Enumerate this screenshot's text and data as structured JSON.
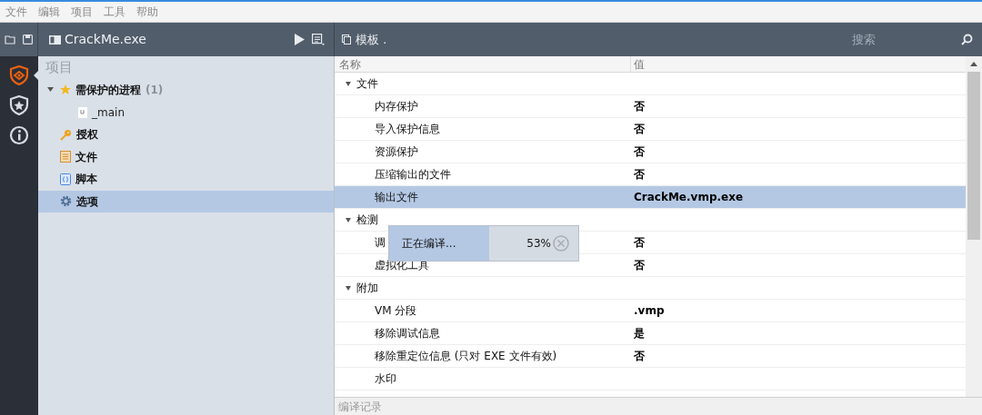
{
  "menu": [
    "文件",
    "编辑",
    "项目",
    "工具",
    "帮助"
  ],
  "toolbar": {
    "file_name": "CrackMe.exe",
    "template": "模板 .",
    "search": {
      "placeholder": "搜索"
    }
  },
  "rail": [
    {
      "kind": "protect",
      "selected": true
    },
    {
      "kind": "license",
      "selected": false
    },
    {
      "kind": "info",
      "selected": false
    }
  ],
  "sidebar": {
    "title": "项目",
    "items": [
      {
        "kind": "star",
        "label": "需保护的进程",
        "count": "(1)",
        "expanded": true,
        "selected": false,
        "children": [
          {
            "kind": "unit",
            "label": "_main",
            "selected": false
          }
        ]
      },
      {
        "kind": "key",
        "label": "授权",
        "selected": false
      },
      {
        "kind": "file",
        "label": "文件",
        "selected": false
      },
      {
        "kind": "script",
        "label": "脚本",
        "selected": false
      },
      {
        "kind": "gear",
        "label": "选项",
        "selected": true
      }
    ]
  },
  "table": {
    "columns": [
      "名称",
      "值"
    ],
    "groups": [
      {
        "label": "文件",
        "expanded": true,
        "rows": [
          {
            "name": "内存保护",
            "value": "否",
            "selected": false
          },
          {
            "name": "导入保护信息",
            "value": "否",
            "selected": false
          },
          {
            "name": "资源保护",
            "value": "否",
            "selected": false
          },
          {
            "name": "压缩输出的文件",
            "value": "否",
            "selected": false
          },
          {
            "name": "输出文件",
            "value": "CrackMe.vmp.exe",
            "selected": true
          }
        ]
      },
      {
        "label": "检测",
        "expanded": true,
        "rows": [
          {
            "name": "调",
            "value": "否",
            "selected": false
          },
          {
            "name": "虚拟化工具",
            "value": "否",
            "selected": false
          }
        ]
      },
      {
        "label": "附加",
        "expanded": true,
        "rows": [
          {
            "name": "VM 分段",
            "value": ".vmp",
            "selected": false
          },
          {
            "name": "移除调试信息",
            "value": "是",
            "selected": false
          },
          {
            "name": "移除重定位信息 (只对 EXE 文件有效)",
            "value": "否",
            "selected": false
          },
          {
            "name": "水印",
            "value": "",
            "selected": false
          }
        ]
      }
    ]
  },
  "progress": {
    "label": "正在编译...",
    "reading": "53%",
    "level": 0.53
  },
  "log_panel": {
    "title": "编译记录"
  }
}
